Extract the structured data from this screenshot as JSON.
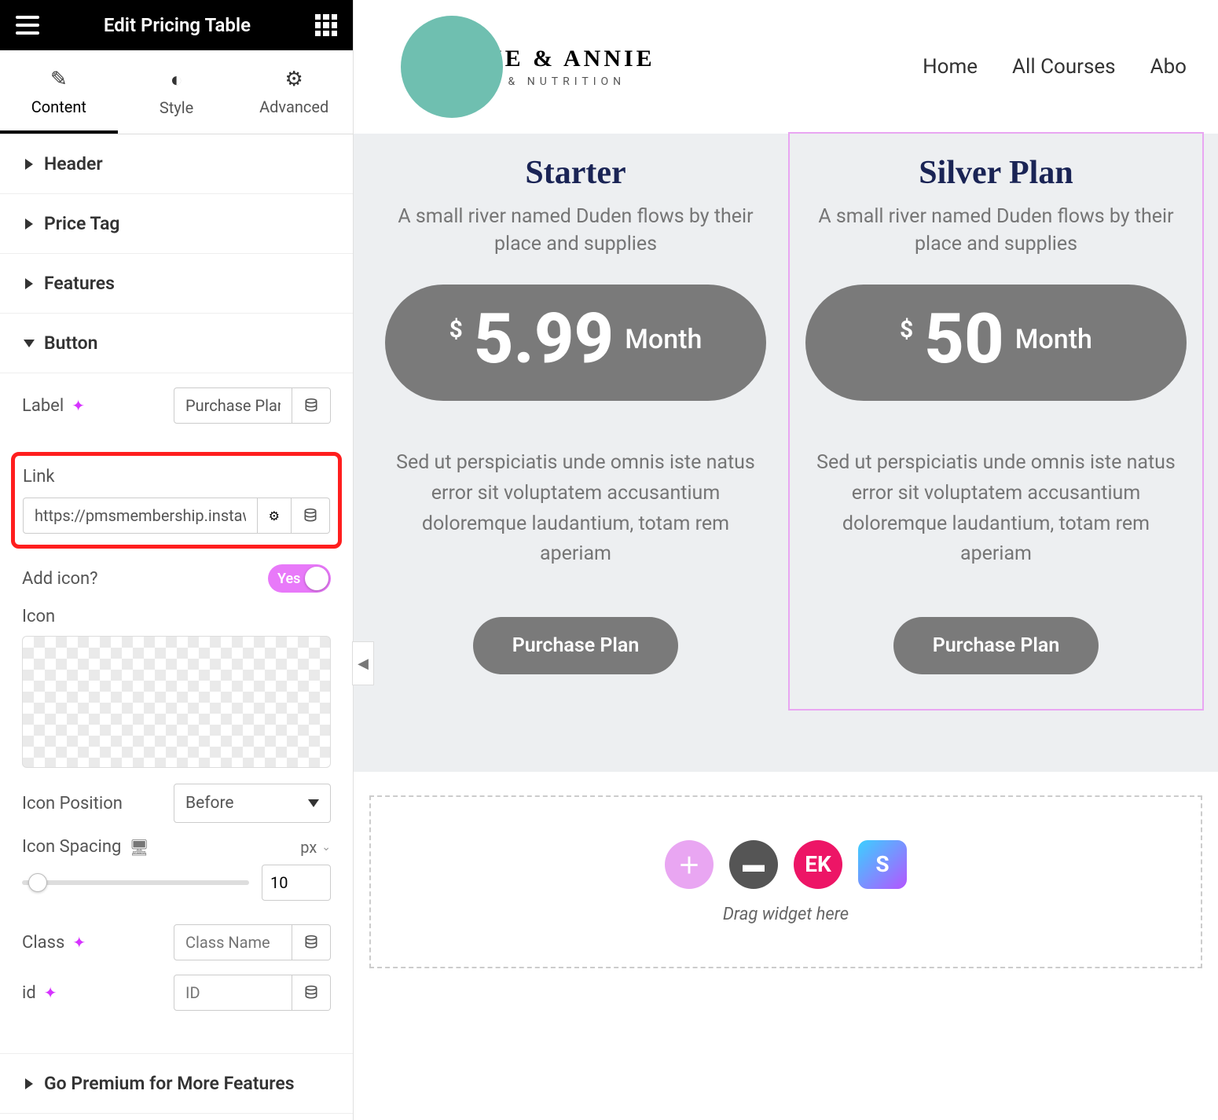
{
  "header": {
    "title": "Edit Pricing Table"
  },
  "tabs": {
    "content": "Content",
    "style": "Style",
    "advanced": "Advanced"
  },
  "sections": {
    "header": "Header",
    "price_tag": "Price Tag",
    "features": "Features",
    "button": "Button",
    "premium": "Go Premium for More Features"
  },
  "button_panel": {
    "label_label": "Label",
    "label_value": "Purchase Plan",
    "link_label": "Link",
    "link_value": "https://pmsmembership.instawp.x",
    "add_icon_label": "Add icon?",
    "add_icon_value": "Yes",
    "icon_label": "Icon",
    "icon_position_label": "Icon Position",
    "icon_position_value": "Before",
    "icon_spacing_label": "Icon Spacing",
    "icon_spacing_unit": "px",
    "icon_spacing_value": "10",
    "class_label": "Class",
    "class_placeholder": "Class Name",
    "id_label": "id",
    "id_placeholder": "ID"
  },
  "site": {
    "logo_main": "JAMIE & ANNIE",
    "logo_sub": "HEALTH & NUTRITION",
    "nav": [
      "Home",
      "All Courses",
      "Abo"
    ]
  },
  "plans": [
    {
      "title": "Starter",
      "desc": "A small river named Duden flows by their place and supplies",
      "currency": "$",
      "amount": "5.99",
      "period": "Month",
      "body": "Sed ut perspiciatis unde omnis iste natus error sit voluptatem accusantium doloremque laudantium, totam rem aperiam",
      "button": "Purchase Plan"
    },
    {
      "title": "Silver Plan",
      "desc": "A small river named Duden flows by their place and supplies",
      "currency": "$",
      "amount": "50",
      "period": "Month",
      "body": "Sed ut perspiciatis unde omnis iste natus error sit voluptatem accusantium doloremque laudantium, totam rem aperiam",
      "button": "Purchase Plan"
    }
  ],
  "drop": {
    "text": "Drag widget here"
  }
}
